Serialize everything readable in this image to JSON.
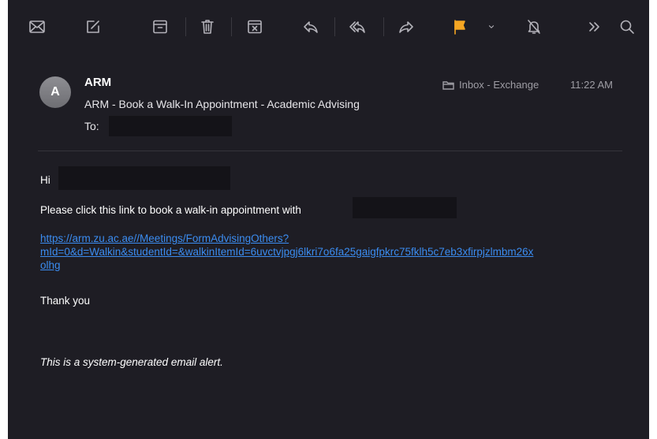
{
  "toolbar": {
    "buttons": [
      {
        "icon": "envelope-icon"
      },
      {
        "icon": "compose-icon"
      },
      {
        "icon": "archive-icon"
      },
      {
        "icon": "trash-icon"
      },
      {
        "icon": "junk-icon"
      },
      {
        "icon": "reply-icon"
      },
      {
        "icon": "reply-all-icon"
      },
      {
        "icon": "forward-icon"
      },
      {
        "icon": "flag-icon",
        "color": "#f5a623"
      },
      {
        "icon": "chevron-down-icon"
      },
      {
        "icon": "mute-bell-icon"
      },
      {
        "icon": "more-chevrons-icon"
      },
      {
        "icon": "search-icon"
      }
    ]
  },
  "message": {
    "avatar_initial": "A",
    "sender": "ARM",
    "subject": "ARM - Book a Walk-In Appointment - Academic Advising",
    "to_label": "To:",
    "mailbox": "Inbox - Exchange",
    "time": "11:22 AM"
  },
  "body": {
    "greeting": "Hi",
    "intro": "Please click this link to book a walk-in appointment with",
    "link_line1": "https://arm.zu.ac.ae//Meetings/FormAdvisingOthers?",
    "link_line2": "mId=0&d=Walkin&studentId=&walkinItemId=6uvctvjpgj6lkri7o6fa25gaigfpkrc75fklh5c7eb3xfirpjzlmbm26x",
    "link_line3": "olhg",
    "thanks": "Thank you",
    "footer": "This is a system-generated email alert."
  },
  "colors": {
    "background": "#1e1d24",
    "link": "#3b8cf0",
    "flag": "#f5a623"
  }
}
